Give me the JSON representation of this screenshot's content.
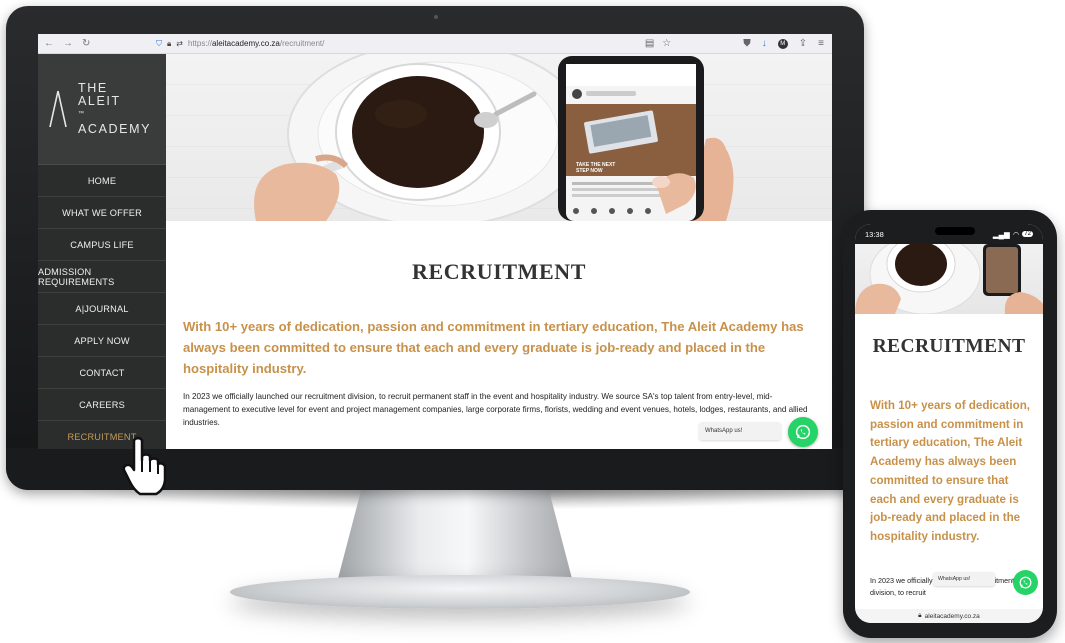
{
  "browser": {
    "url_protocol": "https://",
    "url_domain": "aleitacademy.co.za",
    "url_path": "/recruitment/"
  },
  "logo": {
    "line1": "THE",
    "line2": "ALEIT",
    "line2_tm": "™",
    "line3": "ACADEMY"
  },
  "menu": [
    {
      "label": "HOME"
    },
    {
      "label": "WHAT WE OFFER"
    },
    {
      "label": "CAMPUS LIFE"
    },
    {
      "label": "ADMISSION REQUIREMENTS"
    },
    {
      "label": "A|JOURNAL"
    },
    {
      "label": "APPLY NOW"
    },
    {
      "label": "CONTACT"
    },
    {
      "label": "CAREERS"
    },
    {
      "label": "RECRUITMENT"
    }
  ],
  "page": {
    "title": "RECRUITMENT",
    "lead": "With 10+ years of dedication, passion and commitment in tertiary education, The Aleit Academy has always been committed to ensure that each and every graduate is job-ready and placed in the hospitality industry.",
    "body": "In 2023 we officially launched our recruitment division, to recruit permanent staff in the event and hospitality industry. We source SA's top talent from entry-level, mid-management to executive level for event and project management companies, large corporate firms, florists, wedding and event venues, hotels, lodges, restaurants, and allied industries.",
    "whatsapp_label": "WhatsApp us!"
  },
  "hero_phone": {
    "caption_line1": "TAKE THE NEXT",
    "caption_line2": "STEP NOW"
  },
  "phone": {
    "time": "13:38",
    "battery": "72",
    "title": "RECRUITMENT",
    "lead": "With 10+ years of dedication, passion and commitment in tertiary education, The Aleit Academy has always been committed to ensure that each and every graduate is job-ready and placed in the hospitality industry.",
    "body": "In 2023 we officially launched our recruitment division, to recruit",
    "whatsapp_label": "WhatsApp us!",
    "url": "aleitacademy.co.za"
  },
  "colors": {
    "accent_gold": "#c8914a",
    "sidebar_bg": "#2b2d2d",
    "whatsapp_green": "#25d366"
  }
}
